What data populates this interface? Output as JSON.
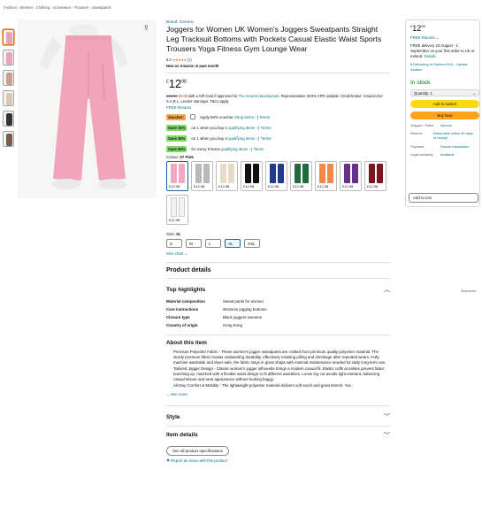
{
  "breadcrumb": [
    "Fashion",
    "Women",
    "Clothing",
    "Activewear",
    "Trousers",
    "Sweatpants"
  ],
  "brand": "Brand: Generic",
  "title": "Joggers for Women UK Women's Joggers Sweatpants Straight Leg Tracksuit Bottoms with Pockets Casual Elastic Waist Sports Trousers Yoga Fitness Gym Lounge Wear",
  "rating": {
    "value": "5.0",
    "stars": "★★★★★",
    "count": "(2)"
  },
  "new_on": "New on Amazon in past month",
  "price": {
    "currency": "£",
    "whole": "12",
    "fraction": "98"
  },
  "rrp_line": {
    "old": "£12.98",
    "new": "£0.00",
    "text": "with a Gift Card if approved for",
    "link": "The Amazon Barclaycard",
    "rest": ". Representative 28.9% APR variable.",
    "credit": "Credit broker: Amazon EU S.À.R.L. Lender: Barclays. T&Cs apply."
  },
  "free_returns": "FREE Returns",
  "offers": [
    {
      "badge": "Voucher:",
      "kind": "v",
      "text": "Apply 50% voucher",
      "link": "Shop items",
      "terms": "Terms"
    },
    {
      "badge": "Save 15%",
      "kind": "g",
      "text": "on 1 when you buy 2",
      "link": "qualifying items",
      "terms": "Terms"
    },
    {
      "badge": "Save 35%",
      "kind": "g",
      "text": "on 1 when you buy 4",
      "link": "qualifying items",
      "terms": "Terms"
    },
    {
      "badge": "Save 50%",
      "kind": "g",
      "text": "for every 6 items",
      "link": "qualifying items",
      "terms": "Terms"
    }
  ],
  "colour_label": "Colour:",
  "colour_value": "07 Pink",
  "swatch_price": "£12.98",
  "swatches": [
    {
      "color": "#f2a7c3"
    },
    {
      "color": "#b9b9b9"
    },
    {
      "color": "#e8dcc8"
    },
    {
      "color": "#111111"
    },
    {
      "color": "#1f3c8c"
    },
    {
      "color": "#1e6b3b"
    },
    {
      "color": "#f08a4b"
    },
    {
      "color": "#6b2f8a"
    },
    {
      "color": "#7a1622"
    },
    {
      "color": "#f4f4f4"
    }
  ],
  "size_label": "Size:",
  "size_value": "XL",
  "sizes": [
    "S",
    "M",
    "L",
    "XL",
    "XXL"
  ],
  "size_chart": "Size chart",
  "product_details": "Product details",
  "top_highlights": "Top highlights",
  "specs": [
    {
      "k": "Material composition",
      "v": "Sweat pants for women"
    },
    {
      "k": "Care instructions",
      "v": "Womens jogging bottoms"
    },
    {
      "k": "Closure type",
      "v": "Black joggers womens"
    },
    {
      "k": "Country of origin",
      "v": "Hong Kong"
    }
  ],
  "about_title": "About this item",
  "about": [
    "Premium Polyester Fabric - These women's jogger sweatpants are crafted from premium quality polyester material. The sturdy premium fabric boasts outstanding durability, effectively resisting pilling and shrinkage after repeated wears. Fully machine washable and dryer-safe, the fabric stays in great shape with minimal maintenance needed for daily long-term use.",
    "Tailored Jogger Design - Classic women's jogger silhouette brings a modern casual fit. Elastic cuffs at ankles prevent fabric bunching up, matched with a flexible waist design to fit different waistlines. Loose leg cut avoids tight restraint, balancing casual leisure and neat appearance without looking baggy.",
    "All-Day Comfort & Mobility - The lightweight polyester material delivers soft touch and great stretch. You"
  ],
  "see_more": "See more",
  "style": "Style",
  "item_details": "Item details",
  "see_all_specs": "See all product specifications",
  "report": "Report an issue with this product",
  "sponsored": "Sponsored",
  "buybox": {
    "price": {
      "currency": "£",
      "whole": "12",
      "fraction": "98"
    },
    "free_returns": "FREE Returns",
    "delivery": "FREE delivery 23 August - 1 September on your first order to UK or Ireland.",
    "delivery_link": "Details",
    "location": "Delivering to Durham DH1 - Update location",
    "stock": "In stock",
    "quantity": "Quantity: 1",
    "add_to_basket": "Add to basket",
    "buy_now": "Buy Now",
    "details": [
      {
        "k": "Shipper / Seller",
        "v": "Alcorze"
      },
      {
        "k": "Returns",
        "v": "Returnable within 30 days of receipt"
      },
      {
        "k": "Payment",
        "v": "Secure transaction"
      },
      {
        "k": "Legal warranty",
        "v": "Available"
      }
    ],
    "add_to_list": "Add to List"
  }
}
